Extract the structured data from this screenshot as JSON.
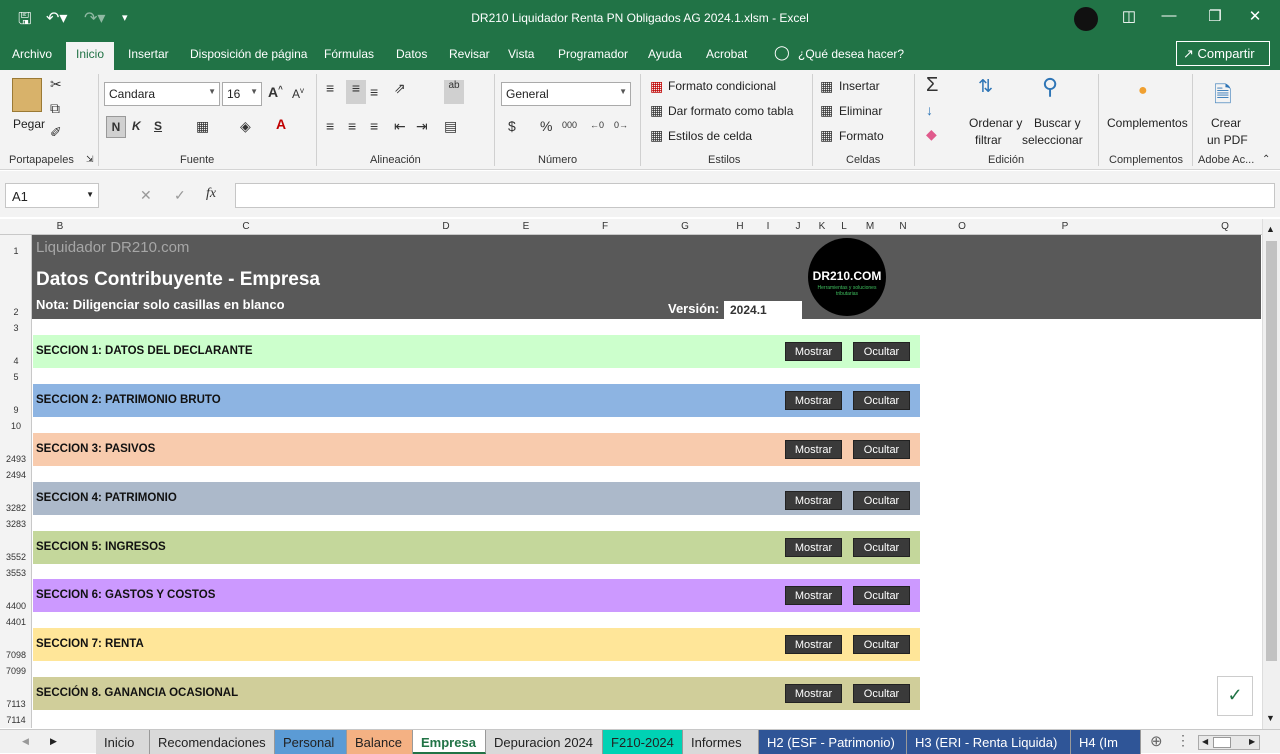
{
  "window": {
    "title": "DR210 Liquidador Renta PN Obligados AG 2024.1.xlsm  -  Excel"
  },
  "tabs": [
    "Archivo",
    "Inicio",
    "Insertar",
    "Disposición de página",
    "Fórmulas",
    "Datos",
    "Revisar",
    "Vista",
    "Programador",
    "Ayuda",
    "Acrobat",
    "¿Qué desea hacer?"
  ],
  "share_label": "Compartir",
  "ribbon": {
    "paste": "Pegar",
    "groups": [
      "Portapapeles",
      "Fuente",
      "Alineación",
      "Número",
      "Estilos",
      "Celdas",
      "Edición",
      "Complementos",
      "Adobe Ac..."
    ],
    "font_name": "Candara",
    "font_size": "16",
    "number_format": "General",
    "bold": "N",
    "italic": "K",
    "underline": "S",
    "cond_format": "Formato condicional",
    "table_format": "Dar formato como tabla",
    "cell_styles": "Estilos de celda",
    "insert": "Insertar",
    "delete": "Eliminar",
    "format": "Formato",
    "sort_1": "Ordenar y",
    "sort_2": "filtrar",
    "find_1": "Buscar y",
    "find_2": "seleccionar",
    "complementos": "Complementos",
    "pdf_1": "Crear",
    "pdf_2": "un PDF"
  },
  "namebox": "A1",
  "columns": [
    "B",
    "C",
    "D",
    "E",
    "F",
    "G",
    "H",
    "I",
    "J",
    "K",
    "L",
    "M",
    "N",
    "O",
    "P",
    "Q"
  ],
  "rows": [
    "1",
    "2",
    "3",
    "4",
    "5",
    "9",
    "10",
    "2493",
    "2494",
    "3282",
    "3283",
    "3552",
    "3553",
    "4400",
    "4401",
    "7098",
    "7099",
    "7113",
    "7114"
  ],
  "banner": {
    "brand": "Liquidador DR210.com",
    "title": "Datos Contribuyente - Empresa",
    "note": "Nota: Diligenciar solo casillas en blanco",
    "version_label": "Versión:",
    "version": "2024.1",
    "logo_text": "DR210.COM",
    "logo_sub": "Herramientas y soluciones tributarias"
  },
  "buttons": {
    "show": "Mostrar",
    "hide": "Ocultar"
  },
  "sections": [
    {
      "label": "SECCION 1: DATOS DEL DECLARANTE",
      "color": "#ccffcc"
    },
    {
      "label": "SECCION 2: PATRIMONIO BRUTO",
      "color": "#8db4e2"
    },
    {
      "label": "SECCION 3:  PASIVOS",
      "color": "#f8cbad"
    },
    {
      "label": "SECCION 4: PATRIMONIO",
      "color": "#acb9ca"
    },
    {
      "label": "SECCION 5: INGRESOS",
      "color": "#c4d79b"
    },
    {
      "label": "SECCION 6: GASTOS Y COSTOS",
      "color": "#cc99ff"
    },
    {
      "label": "SECCION 7: RENTA",
      "color": "#ffe699"
    },
    {
      "label": "SECCIÓN 8. GANANCIA OCASIONAL",
      "color": "#d0ce9a"
    }
  ],
  "sheets": [
    {
      "name": "Inicio",
      "color": "#d9d9d9"
    },
    {
      "name": "Recomendaciones",
      "color": "#d9d9d9"
    },
    {
      "name": "Personal",
      "color": "#5b9bd5"
    },
    {
      "name": "Balance",
      "color": "#f4b183"
    },
    {
      "name": "Empresa",
      "color": "#ffffff"
    },
    {
      "name": "Depuracion 2024",
      "color": "#d9d9d9"
    },
    {
      "name": "F210-2024",
      "color": "#00d2b4"
    },
    {
      "name": "Informes",
      "color": "#d9d9d9"
    },
    {
      "name": "H2 (ESF - Patrimonio)",
      "color": "#2f5597"
    },
    {
      "name": "H3 (ERI - Renta Liquida)",
      "color": "#2f5597"
    },
    {
      "name": "H4 (Im",
      "color": "#2f5597"
    }
  ]
}
